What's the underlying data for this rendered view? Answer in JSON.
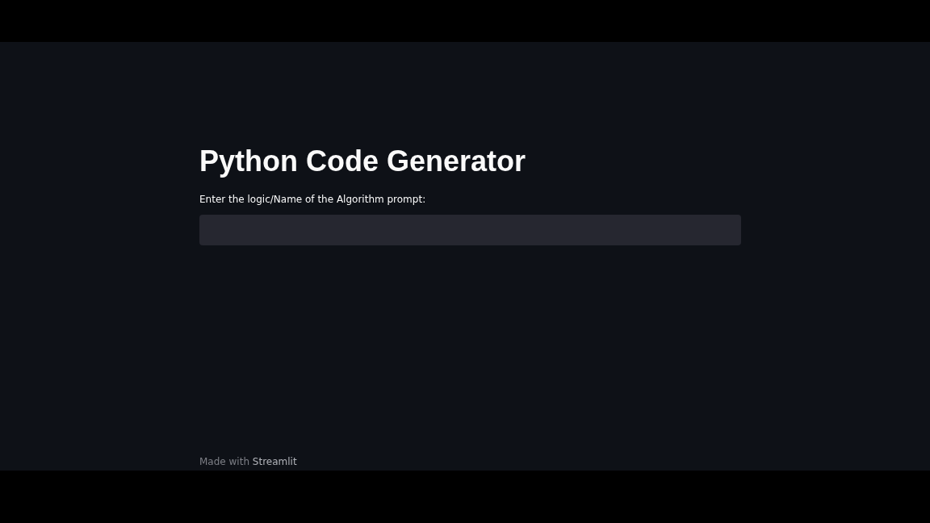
{
  "title": "Python Code Generator",
  "prompt_field": {
    "label": "Enter the logic/Name of the Algorithm prompt:"
  },
  "footer": {
    "text": "Made with",
    "link": "Streamlit"
  }
}
